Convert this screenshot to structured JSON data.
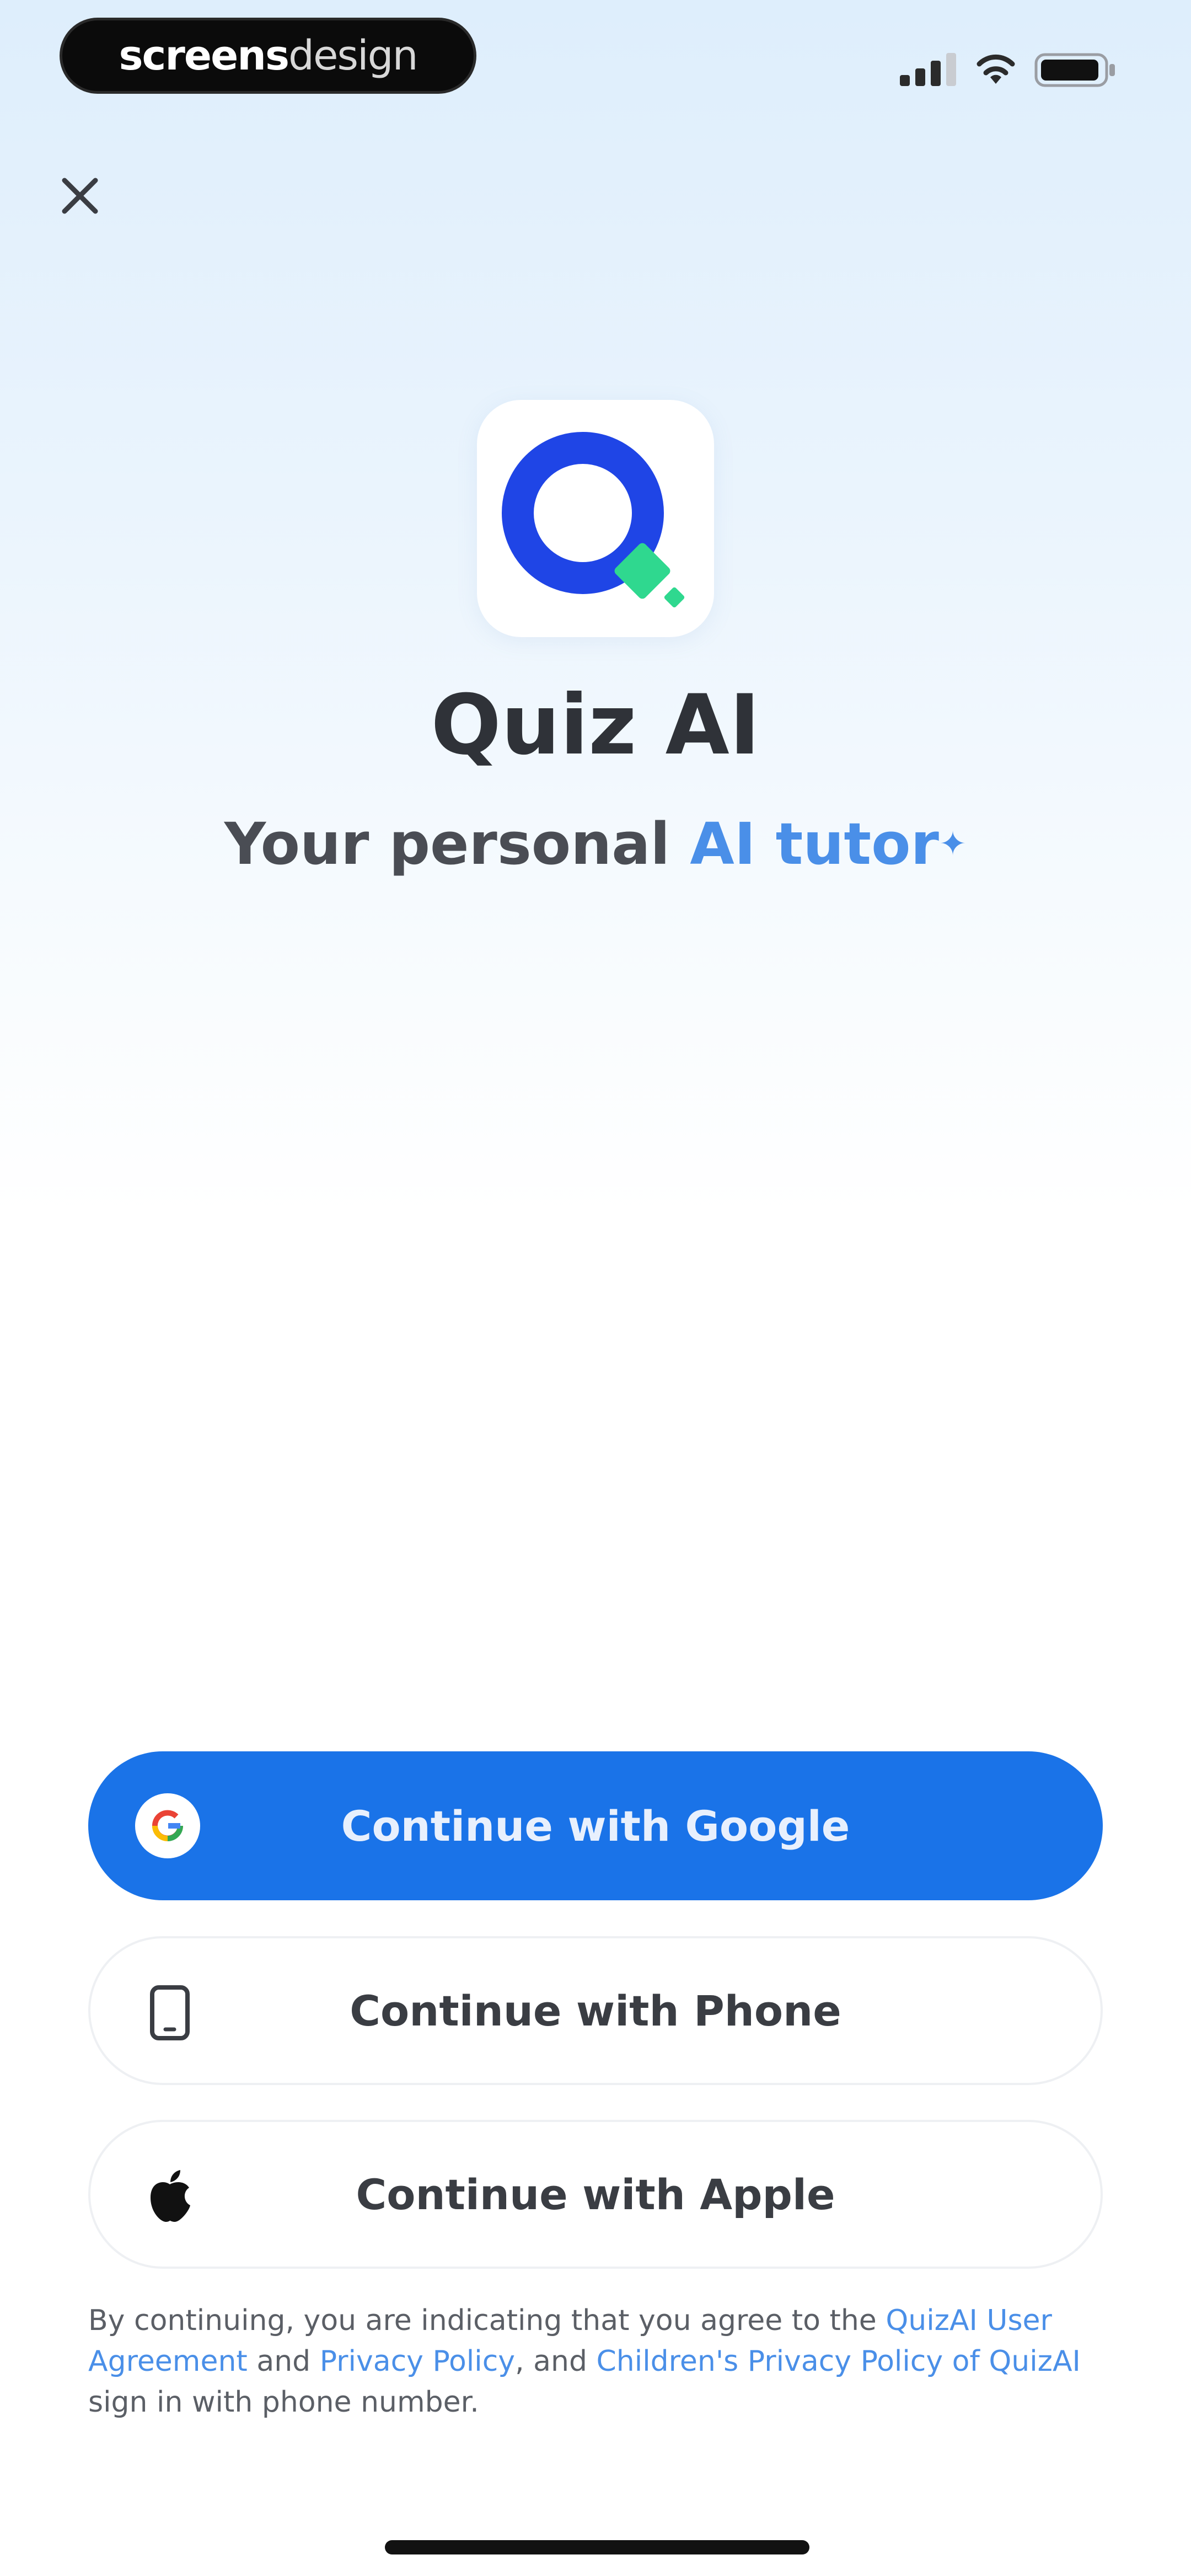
{
  "status_bar": {
    "brand_part1": "screens",
    "brand_part2": "design"
  },
  "icons": {
    "close": "close-icon",
    "google": "google-icon",
    "phone": "phone-icon",
    "apple": "apple-icon"
  },
  "hero": {
    "app_name": "Quiz AI",
    "tagline_prefix": "Your personal ",
    "tagline_accent": "AI tutor",
    "tagline_sparkle": "✦"
  },
  "buttons": {
    "google": "Continue with Google",
    "phone": "Continue with Phone",
    "apple": "Continue with Apple"
  },
  "legal": {
    "text1": "By continuing, you are indicating that you agree to the ",
    "link1": "QuizAI User Agreement",
    "text2": " and ",
    "link2": "Privacy Policy",
    "text3": ", and ",
    "link3": "Children's Privacy Policy of QuizAI",
    "text4": " sign in with phone number."
  },
  "colors": {
    "primary": "#1a73e8",
    "accent": "#4a8fe8",
    "logo_blue": "#1f45e6",
    "logo_green": "#2fd88f",
    "text_dark": "#2f3238"
  }
}
